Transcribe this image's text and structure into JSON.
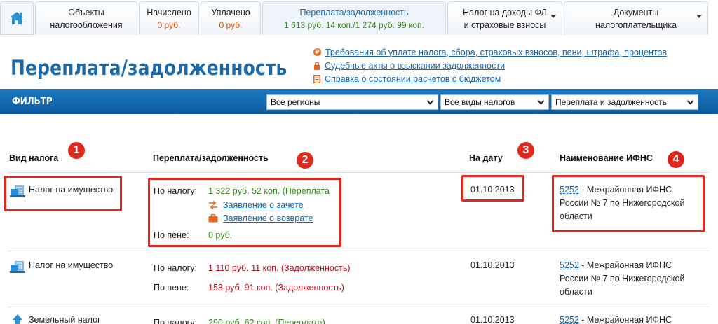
{
  "nav": {
    "tabs": [
      {
        "title_line1": "Объекты",
        "title_line2": "налогообложения",
        "value": ""
      },
      {
        "title_line1": "Начислено",
        "title_line2": "",
        "value": "0 руб."
      },
      {
        "title_line1": "Уплачено",
        "title_line2": "",
        "value": "0 руб."
      },
      {
        "title_line1": "Переплата/задолженность",
        "title_line2": "",
        "value": "1 613 руб. 14 коп./1 274 руб. 99 коп."
      },
      {
        "title_line1": "Налог на доходы ФЛ",
        "title_line2": "и страховые взносы",
        "value": ""
      },
      {
        "title_line1": "Документы",
        "title_line2": "налогоплательщика",
        "value": ""
      }
    ]
  },
  "page": {
    "title": "Переплата/задолженность",
    "links": [
      "Требования об уплате налога, сбора, страховых взносов, пени, штрафа, процентов",
      "Судебные акты о взыскании задолженности",
      "Справка о состоянии расчетов с бюджетом"
    ]
  },
  "filter": {
    "label": "ФИЛЬТР",
    "region": "Все регионы",
    "tax_type": "Все виды налогов",
    "status": "Переплата и задолженность"
  },
  "table": {
    "headers": [
      "Вид налога",
      "Переплата/задолженность",
      "На дату",
      "Наименование ИФНС"
    ],
    "badges": [
      "1",
      "2",
      "3",
      "4"
    ],
    "label_tax": "По налогу:",
    "label_penalty": "По пене:",
    "rows": [
      {
        "tax": "Налог на имущество",
        "tax_amount": "1 322 руб. 52 коп. (Переплата",
        "action_offset": "Заявление о зачете",
        "action_refund": "Заявление о возврате",
        "penalty_amount": "0 руб.",
        "date": "01.10.2013",
        "ifns_code": "5252",
        "ifns_line1": " - Межрайонная ИФНС",
        "ifns_line2": "России № 7 по Нижегородской",
        "ifns_line3": "области"
      },
      {
        "tax": "Налог на имущество",
        "tax_amount": "1 110 руб. 11 коп. (Задолженность)",
        "penalty_amount": "153 руб. 91 коп. (Задолженность)",
        "date": "01.10.2013",
        "ifns_code": "5252",
        "ifns_line1": " - Межрайонная ИФНС",
        "ifns_line2": "России № 7 по Нижегородской",
        "ifns_line3": "области"
      },
      {
        "tax": "Земельный налог",
        "tax_amount": "290 руб. 62 коп. (Переплата)",
        "date": "01.10.2013",
        "ifns_code": "5252",
        "ifns_line1": " - Межрайонная ИФНС"
      }
    ]
  },
  "colors": {
    "brand_blue": "#1c6aa7",
    "overpay_green": "#3a8a1f",
    "debt_red": "#b8101e",
    "accent_orange": "#e64d00",
    "highlight_red": "#e0281e"
  },
  "icons": [
    "home-icon",
    "request-icon",
    "court-lock-icon",
    "certificate-icon",
    "property-tax-icon",
    "land-tax-icon",
    "offset-icon",
    "refund-icon",
    "chevron-down-icon"
  ]
}
